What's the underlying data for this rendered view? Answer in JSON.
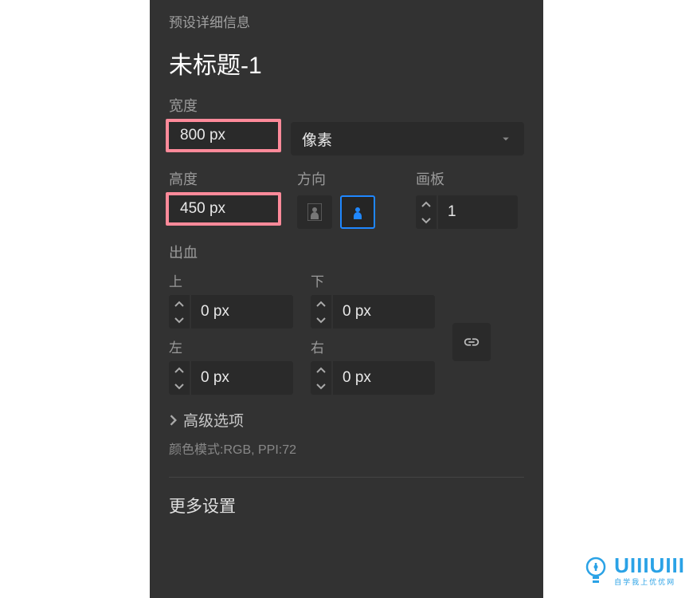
{
  "preset_detail_label": "预设详细信息",
  "title": "未标题-1",
  "width": {
    "label": "宽度",
    "value": "800 px",
    "unit": "像素"
  },
  "height": {
    "label": "高度",
    "value": "450 px"
  },
  "orientation": {
    "label": "方向"
  },
  "artboard": {
    "label": "画板",
    "value": "1"
  },
  "bleed": {
    "label": "出血",
    "top": {
      "label": "上",
      "value": "0 px"
    },
    "bottom": {
      "label": "下",
      "value": "0 px"
    },
    "left": {
      "label": "左",
      "value": "0 px"
    },
    "right": {
      "label": "右",
      "value": "0 px"
    }
  },
  "advanced_options": "高级选项",
  "color_mode": "颜色模式:RGB, PPI:72",
  "more_settings": "更多设置",
  "watermark": {
    "brand": "UIIIUIII",
    "sub": "自学我上优优网"
  }
}
